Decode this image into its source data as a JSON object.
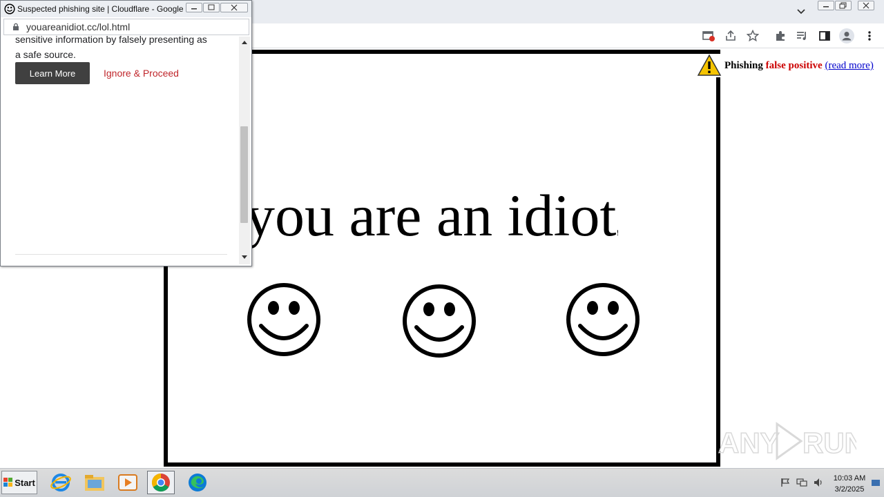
{
  "popup": {
    "window_title": "Suspected phishing site | Cloudflare - Google C...",
    "url": "youareanidiot.cc/lol.html",
    "body_line1": "sensitive information by falsely presenting as",
    "body_line2": "a safe source.",
    "learn_more": "Learn More",
    "ignore_proceed": "Ignore & Proceed"
  },
  "page": {
    "headline": "you are an idiot",
    "trailing_mark": "!",
    "smiley_glyph": "☺",
    "phishing_label": "Phishing",
    "false_positive": "false positive",
    "read_more": "(read more)"
  },
  "watermark": "ANY RUN",
  "taskbar": {
    "start_label": "Start",
    "time": "10:03 AM",
    "date": "3/2/2025",
    "apps": [
      "internet-explorer-icon",
      "file-explorer-icon",
      "media-player-icon",
      "chrome-icon",
      "edge-icon"
    ]
  },
  "colors": {
    "warning_red": "#cc0000",
    "link_blue": "#0000cc",
    "ignore_red": "#c0262b",
    "button_dark": "#404040"
  }
}
